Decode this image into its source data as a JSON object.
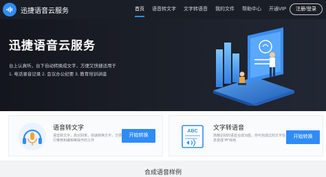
{
  "brand": {
    "name": "迅捷语音云服务",
    "logo_icon": "soundwave-icon"
  },
  "nav": {
    "items": [
      {
        "label": "首页",
        "active": true
      },
      {
        "label": "语音转文字",
        "active": false
      },
      {
        "label": "文字转语音",
        "active": false
      },
      {
        "label": "我的文件",
        "active": false
      },
      {
        "label": "帮助中心",
        "active": false
      },
      {
        "label": "开通VIP",
        "active": false
      }
    ],
    "auth_label": "注册/登录"
  },
  "hero": {
    "title": "迅捷语音云服务",
    "desc_line1": "台上认真听，台下自动转换成文字，方便又快捷适用于",
    "desc_line2": "1. 电话录音记录  2. 会议办公纪要  3. 教育培训讲座",
    "slides": 2,
    "active_slide": 2
  },
  "services": [
    {
      "title": "语音转文字",
      "desc": "语音转文字，高识别率，快速转换文字，方便进行推荐和编辑等操作的工作",
      "button": "开始转换",
      "icon": "headphones-mic-icon"
    },
    {
      "title": "文字转语音",
      "desc": "高精识别的语音合成功能，你可完成过的文字信息变成“声”绘色",
      "button": "开始转换",
      "icon": "abc-document-icon"
    }
  ],
  "section": {
    "title": "合成语音样例"
  },
  "colors": {
    "accent": "#2f8cf5",
    "header_bg": "#1a1e26",
    "hero_bg": "#1b1f28"
  }
}
